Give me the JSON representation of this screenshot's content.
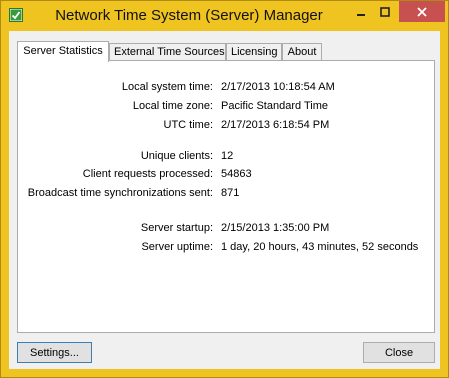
{
  "window": {
    "title": "Network Time System (Server) Manager",
    "colors": {
      "frame": "#f0c420",
      "close_button": "#c75050",
      "app_icon": "#3a9a3a"
    }
  },
  "tabs": [
    {
      "label": "Server Statistics",
      "active": true
    },
    {
      "label": "External Time Sources",
      "active": false
    },
    {
      "label": "Licensing",
      "active": false
    },
    {
      "label": "About",
      "active": false
    }
  ],
  "stats": {
    "local_system_time": {
      "label": "Local system time:",
      "value": "2/17/2013 10:18:54 AM"
    },
    "local_time_zone": {
      "label": "Local time zone:",
      "value": "Pacific Standard Time"
    },
    "utc_time": {
      "label": "UTC time:",
      "value": "2/17/2013 6:18:54 PM"
    },
    "unique_clients": {
      "label": "Unique clients:",
      "value": "12"
    },
    "client_requests": {
      "label": "Client requests processed:",
      "value": "54863"
    },
    "broadcast_syncs": {
      "label": "Broadcast time synchronizations sent:",
      "value": "871"
    },
    "server_startup": {
      "label": "Server startup:",
      "value": "2/15/2013 1:35:00 PM"
    },
    "server_uptime": {
      "label": "Server uptime:",
      "value": "1 day, 20 hours, 43 minutes, 52 seconds"
    }
  },
  "buttons": {
    "settings": "Settings...",
    "close": "Close"
  }
}
